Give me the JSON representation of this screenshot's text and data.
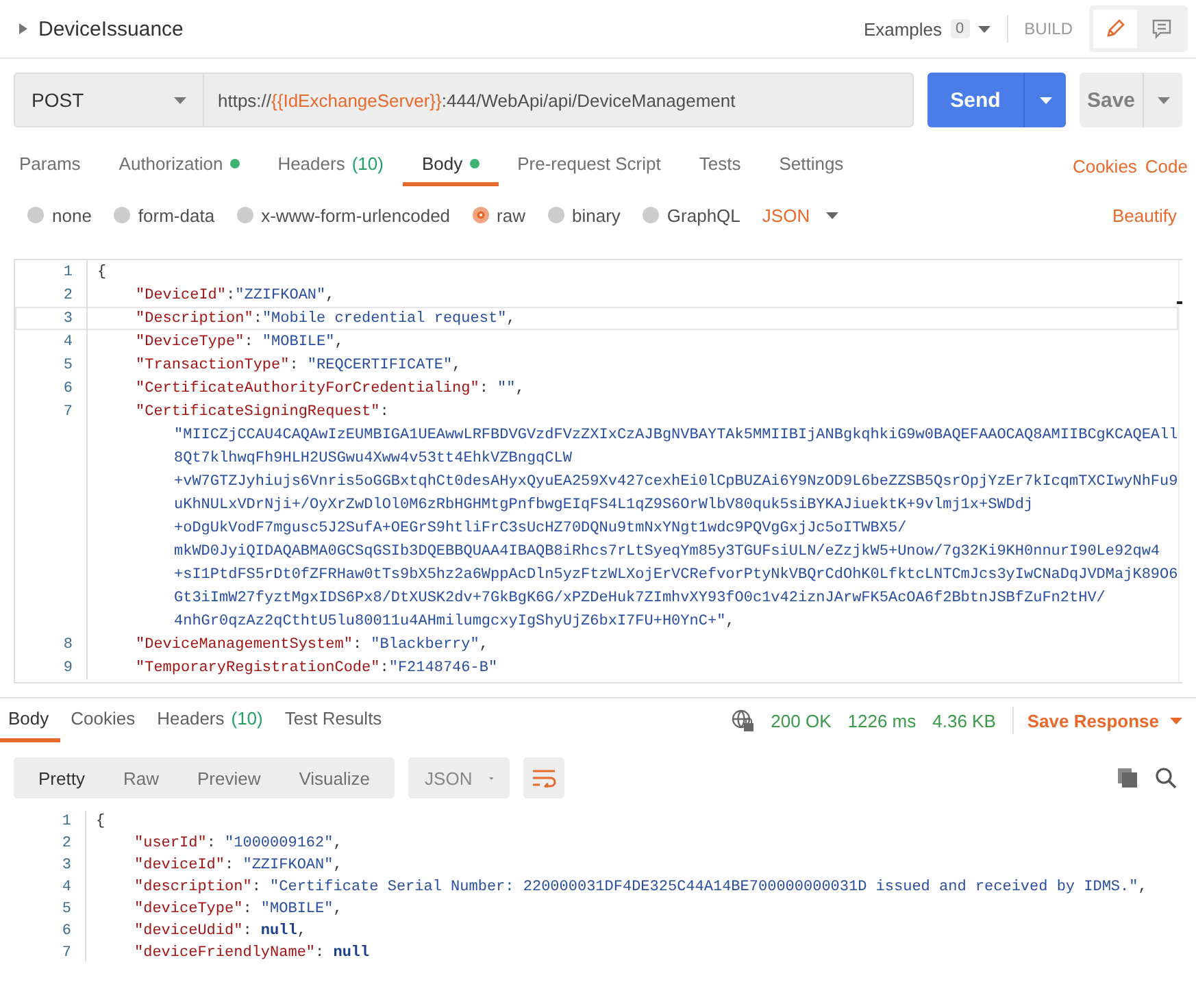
{
  "request_header": {
    "title": "DeviceIssuance",
    "examples_label": "Examples",
    "examples_count": "0",
    "build_label": "BUILD"
  },
  "request": {
    "method": "POST",
    "url_prefix": "https://",
    "url_variable": "{{IdExchangeServer}}",
    "url_suffix": ":444/WebApi/api/DeviceManagement",
    "send": "Send",
    "save": "Save"
  },
  "tabs": [
    {
      "label": "Params",
      "selected": false,
      "dot": false
    },
    {
      "label": "Authorization",
      "selected": false,
      "dot": true
    },
    {
      "label": "Headers",
      "count": "(10)",
      "selected": false,
      "dot": false
    },
    {
      "label": "Body",
      "selected": true,
      "dot": true
    },
    {
      "label": "Pre-request Script",
      "selected": false,
      "dot": false
    },
    {
      "label": "Tests",
      "selected": false,
      "dot": false
    },
    {
      "label": "Settings",
      "selected": false,
      "dot": false
    }
  ],
  "side_links": [
    "Cookies",
    "Code"
  ],
  "body_types": [
    {
      "label": "none",
      "selected": false
    },
    {
      "label": "form-data",
      "selected": false
    },
    {
      "label": "x-www-form-urlencoded",
      "selected": false
    },
    {
      "label": "raw",
      "selected": true
    },
    {
      "label": "binary",
      "selected": false
    },
    {
      "label": "GraphQL",
      "selected": false
    }
  ],
  "body_format": "JSON",
  "beautify": "Beautify",
  "request_body": {
    "lines": [
      {
        "number": "1",
        "kind": "top",
        "active": false,
        "tokens": [
          {
            "kind": "punct",
            "text": "{"
          }
        ]
      },
      {
        "number": "2",
        "kind": "prop",
        "active": false,
        "tokens": [
          {
            "kind": "key",
            "text": "\"DeviceId\""
          },
          {
            "kind": "punct",
            "text": ":"
          },
          {
            "kind": "string",
            "text": "\"ZZIFKOAN\""
          },
          {
            "kind": "punct",
            "text": ","
          }
        ]
      },
      {
        "number": "3",
        "kind": "prop",
        "active": true,
        "tokens": [
          {
            "kind": "key",
            "text": "\"Description\""
          },
          {
            "kind": "punct",
            "text": ":"
          },
          {
            "kind": "string",
            "text": "\"Mobile credential request\""
          },
          {
            "kind": "punct",
            "text": ","
          }
        ]
      },
      {
        "number": "4",
        "kind": "prop",
        "active": false,
        "tokens": [
          {
            "kind": "key",
            "text": "\"DeviceType\""
          },
          {
            "kind": "punct",
            "text": ": "
          },
          {
            "kind": "string",
            "text": "\"MOBILE\""
          },
          {
            "kind": "punct",
            "text": ","
          }
        ]
      },
      {
        "number": "5",
        "kind": "prop",
        "active": false,
        "tokens": [
          {
            "kind": "key",
            "text": "\"TransactionType\""
          },
          {
            "kind": "punct",
            "text": ": "
          },
          {
            "kind": "string",
            "text": "\"REQCERTIFICATE\""
          },
          {
            "kind": "punct",
            "text": ","
          }
        ]
      },
      {
        "number": "6",
        "kind": "prop",
        "active": false,
        "tokens": [
          {
            "kind": "key",
            "text": "\"CertificateAuthorityForCredentialing\""
          },
          {
            "kind": "punct",
            "text": ": "
          },
          {
            "kind": "string",
            "text": "\"\""
          },
          {
            "kind": "punct",
            "text": ","
          }
        ]
      },
      {
        "number": "7",
        "kind": "prop",
        "active": false,
        "tokens": [
          {
            "kind": "key",
            "text": "\"CertificateSigningRequest\""
          },
          {
            "kind": "punct",
            "text": ":"
          }
        ]
      },
      {
        "kind": "wrap",
        "active": false,
        "tokens": [
          {
            "kind": "string",
            "text": "\"MIICZjCCAU4CAQAwIzEUMBIGA1UEAwwLRFBDVGVzdFVzZXIxCzAJBgNVBAYTAk5MMIIBIjANBgkqhkiG9w0BAQEFAAOCAQ8AMIIBCgKCAQEAll"
          }
        ]
      },
      {
        "kind": "wrap",
        "active": false,
        "tokens": [
          {
            "kind": "string",
            "text": "8Qt7klhwqFh9HLH2USGwu4Xww4v53tt4EhkVZBngqCLW"
          }
        ]
      },
      {
        "kind": "wrap",
        "active": false,
        "tokens": [
          {
            "kind": "string",
            "text": "+vW7GTZJyhiujs6Vnris5oGGBxtqhCt0desAHyxQyuEA259Xv427cexhEi0lCpBUZAi6Y9NzOD9L6beZZSB5QsrOpjYzEr7kIcqmTXCIwyNhFu9"
          }
        ]
      },
      {
        "kind": "wrap",
        "active": false,
        "tokens": [
          {
            "kind": "string",
            "text": "uKhNULxVDrNji+/OyXrZwDlOl0M6zRbHGHMtgPnfbwgEIqFS4L1qZ9S6OrWlbV80quk5siBYKAJiuektK+9vlmj1x+SWDdj"
          }
        ]
      },
      {
        "kind": "wrap",
        "active": false,
        "tokens": [
          {
            "kind": "string",
            "text": "+oDgUkVodF7mgusc5J2SufA+OEGrS9htliFrC3sUcHZ70DQNu9tmNxYNgt1wdc9PQVgGxjJc5oITWBX5/"
          }
        ]
      },
      {
        "kind": "wrap",
        "active": false,
        "tokens": [
          {
            "kind": "string",
            "text": "mkWD0JyiQIDAQABMA0GCSqGSIb3DQEBBQUAA4IBAQB8iRhcs7rLtSyeqYm85y3TGUFsiULN/eZzjkW5+Unow/7g32Ki9KH0nnurI90Le92qw4"
          }
        ]
      },
      {
        "kind": "wrap",
        "active": false,
        "tokens": [
          {
            "kind": "string",
            "text": "+sI1PtdFS5rDt0fZFRHaw0tTs9bX5hz2a6WppAcDln5yzFtzWLXojErVCRefvorPtyNkVBQrCdOhK0LfktcLNTCmJcs3yIwCNaDqJVDMajK89O6"
          }
        ]
      },
      {
        "kind": "wrap",
        "active": false,
        "tokens": [
          {
            "kind": "string",
            "text": "Gt3iImW27fyztMgxIDS6Px8/DtXUSK2dv+7GkBgK6G/xPZDeHuk7ZImhvXY93fO0c1v42iznJArwFK5AcOA6f2BbtnJSBfZuFn2tHV/"
          }
        ]
      },
      {
        "kind": "wrap",
        "active": false,
        "tokens": [
          {
            "kind": "string",
            "text": "4nhGr0qzAz2qCthtU5lu80011u4AHmilumgcxyIgShyUjZ6bxI7FU+H0YnC+\""
          },
          {
            "kind": "punct",
            "text": ","
          }
        ]
      },
      {
        "number": "8",
        "kind": "prop",
        "active": false,
        "tokens": [
          {
            "kind": "key",
            "text": "\"DeviceManagementSystem\""
          },
          {
            "kind": "punct",
            "text": ": "
          },
          {
            "kind": "string",
            "text": "\"Blackberry\""
          },
          {
            "kind": "punct",
            "text": ","
          }
        ]
      },
      {
        "number": "9",
        "kind": "prop",
        "active": false,
        "tokens": [
          {
            "kind": "key",
            "text": "\"TemporaryRegistrationCode\""
          },
          {
            "kind": "punct",
            "text": ":"
          },
          {
            "kind": "string",
            "text": "\"F2148746-B\""
          }
        ]
      }
    ]
  },
  "response_tabs": [
    {
      "label": "Body",
      "selected": true
    },
    {
      "label": "Cookies",
      "selected": false
    },
    {
      "label": "Headers",
      "count": "(10)",
      "selected": false
    },
    {
      "label": "Test Results",
      "selected": false
    }
  ],
  "response_status": {
    "status": "200 OK",
    "time": "1226 ms",
    "size": "4.36 KB",
    "save": "Save Response"
  },
  "view_modes": [
    {
      "label": "Pretty",
      "selected": true
    },
    {
      "label": "Raw",
      "selected": false
    },
    {
      "label": "Preview",
      "selected": false
    },
    {
      "label": "Visualize",
      "selected": false
    }
  ],
  "response_format": "JSON",
  "response_body": {
    "lines": [
      {
        "number": "1",
        "kind": "top",
        "tokens": [
          {
            "kind": "punct",
            "text": "{"
          }
        ]
      },
      {
        "number": "2",
        "kind": "prop",
        "tokens": [
          {
            "kind": "key",
            "text": "\"userId\""
          },
          {
            "kind": "punct",
            "text": ": "
          },
          {
            "kind": "string",
            "text": "\"1000009162\""
          },
          {
            "kind": "punct",
            "text": ","
          }
        ]
      },
      {
        "number": "3",
        "kind": "prop",
        "tokens": [
          {
            "kind": "key",
            "text": "\"deviceId\""
          },
          {
            "kind": "punct",
            "text": ": "
          },
          {
            "kind": "string",
            "text": "\"ZZIFKOAN\""
          },
          {
            "kind": "punct",
            "text": ","
          }
        ]
      },
      {
        "number": "4",
        "kind": "prop",
        "tokens": [
          {
            "kind": "key",
            "text": "\"description\""
          },
          {
            "kind": "punct",
            "text": ": "
          },
          {
            "kind": "string",
            "text": "\"Certificate Serial Number: 220000031DF4DE325C44A14BE700000000031D issued and received by IDMS.\""
          },
          {
            "kind": "punct",
            "text": ","
          }
        ]
      },
      {
        "number": "5",
        "kind": "prop",
        "tokens": [
          {
            "kind": "key",
            "text": "\"deviceType\""
          },
          {
            "kind": "punct",
            "text": ": "
          },
          {
            "kind": "string",
            "text": "\"MOBILE\""
          },
          {
            "kind": "punct",
            "text": ","
          }
        ]
      },
      {
        "number": "6",
        "kind": "prop",
        "tokens": [
          {
            "kind": "key",
            "text": "\"deviceUdid\""
          },
          {
            "kind": "punct",
            "text": ": "
          },
          {
            "kind": "literal",
            "text": "null"
          },
          {
            "kind": "punct",
            "text": ","
          }
        ]
      },
      {
        "number": "7",
        "kind": "prop",
        "tokens": [
          {
            "kind": "key",
            "text": "\"deviceFriendlyName\""
          },
          {
            "kind": "punct",
            "text": ": "
          },
          {
            "kind": "literal",
            "text": "null"
          }
        ]
      }
    ]
  }
}
